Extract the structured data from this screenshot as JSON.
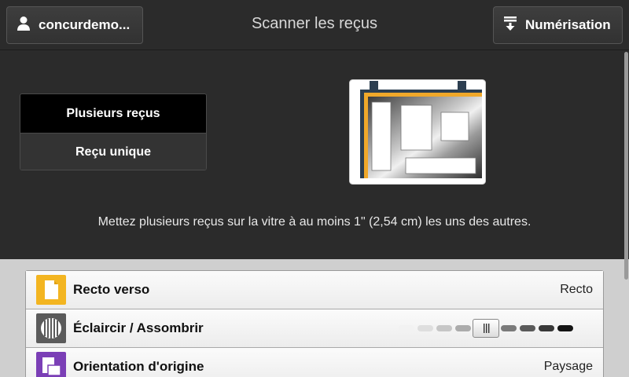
{
  "header": {
    "user_label": "concurdemo...",
    "title": "Scanner les reçus",
    "scan_label": "Numérisation"
  },
  "modes": {
    "multiple": "Plusieurs reçus",
    "single": "Reçu unique",
    "selected": "multiple"
  },
  "instruction": "Mettez plusieurs reçus sur la vitre à au moins 1\" (2,54 cm) les uns des autres.",
  "settings": [
    {
      "label": "Recto verso",
      "value": "Recto",
      "icon": "duplex-page-icon",
      "icon_color": "#f3b521"
    },
    {
      "label": "Éclaircir / Assombrir",
      "icon": "contrast-icon",
      "icon_color": "#5b5b5b",
      "level": 0.5
    },
    {
      "label": "Orientation d'origine",
      "value": "Paysage",
      "icon": "orientation-icon",
      "icon_color": "#7b3fb6"
    }
  ]
}
